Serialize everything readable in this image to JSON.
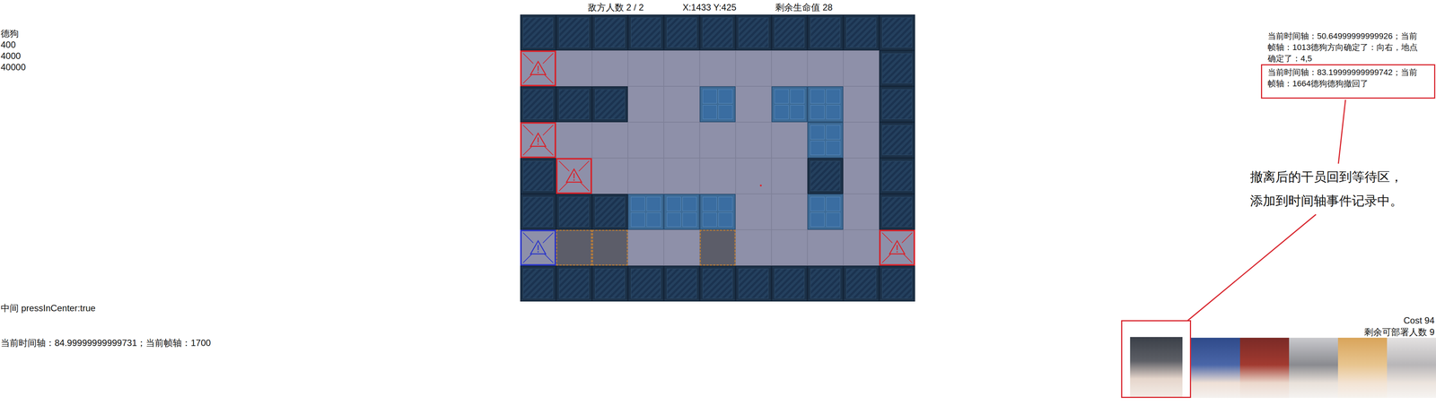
{
  "left_panel": {
    "operator_name": "德狗",
    "values": [
      "400",
      "4000",
      "40000"
    ],
    "center_flag": "中间 pressInCenter:true",
    "timeline": "当前时间轴：84.99999999999731；当前帧轴：1700"
  },
  "top_bar": {
    "enemies": "敌方人数 2 / 2",
    "cursor": "X:1433 Y:425",
    "life": "剩余生命值 28"
  },
  "map": {
    "rows": [
      [
        "wall",
        "wall",
        "wall",
        "wall",
        "wall",
        "wall",
        "wall",
        "wall",
        "wall",
        "wall",
        "wall"
      ],
      [
        "spawn",
        "floor",
        "floor",
        "floor",
        "floor",
        "floor",
        "floor",
        "floor",
        "floor",
        "floor",
        "wall"
      ],
      [
        "wall",
        "wall",
        "wall",
        "floor",
        "floor",
        "high",
        "floor",
        "high",
        "high",
        "floor",
        "wall"
      ],
      [
        "spawn",
        "floor",
        "floor",
        "floor",
        "floor",
        "floor",
        "floor",
        "floor",
        "high",
        "floor",
        "wall"
      ],
      [
        "wall",
        "spawn",
        "floor",
        "floor",
        "floor",
        "floor",
        "floor",
        "floor",
        "wall",
        "floor",
        "wall"
      ],
      [
        "wall",
        "wall",
        "wall",
        "high",
        "high",
        "high",
        "floor",
        "floor",
        "high",
        "floor",
        "wall"
      ],
      [
        "goal",
        "pit",
        "pit",
        "floor",
        "floor",
        "pit",
        "floor",
        "floor",
        "floor",
        "floor",
        "spawn"
      ],
      [
        "wall",
        "wall",
        "wall",
        "wall",
        "wall",
        "wall",
        "wall",
        "wall",
        "wall",
        "wall",
        "wall"
      ]
    ],
    "marker": {
      "row": 4,
      "col": 6
    }
  },
  "event_log": [
    {
      "lines": [
        "当前时间轴：50.64999999999926；当前",
        "帧轴：1013德狗方向确定了：向右，地点",
        "确定了：4,5"
      ],
      "selected": false
    },
    {
      "lines": [
        "当前时间轴：83.19999999999742；当前",
        "帧轴：1664德狗德狗撤回了"
      ],
      "selected": true
    }
  ],
  "annotation": {
    "lines": [
      "撤离后的干员回到等待区，",
      "添加到时间轴事件记录中。"
    ]
  },
  "deploy": {
    "cost": "Cost 94",
    "remaining": "剩余可部署人数 9",
    "operators": [
      {
        "selected": true
      },
      {
        "selected": false
      },
      {
        "selected": false
      },
      {
        "selected": false
      },
      {
        "selected": false
      },
      {
        "selected": false
      }
    ]
  }
}
